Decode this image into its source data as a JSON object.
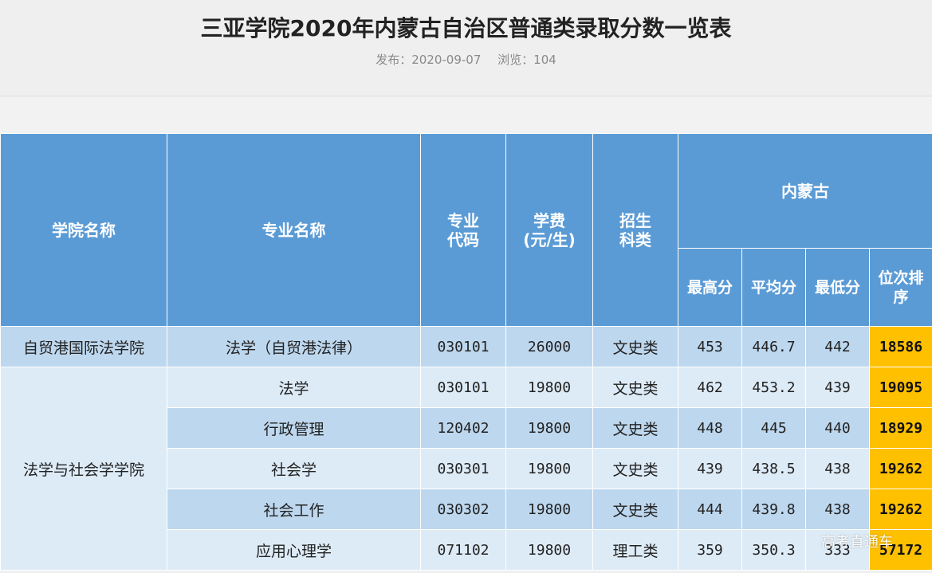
{
  "page": {
    "title": "三亚学院2020年内蒙古自治区普通类录取分数一览表",
    "publish_label": "发布：2020-09-07",
    "views_label": "浏览：104"
  },
  "table": {
    "headers": {
      "college": "学院名称",
      "major": "专业名称",
      "code_line1": "专业",
      "code_line2": "代码",
      "fee_line1": "学费",
      "fee_line2": "(元/生)",
      "category_line1": "招生",
      "category_line2": "科类",
      "region": "内蒙古",
      "max": "最高分",
      "avg": "平均分",
      "min": "最低分",
      "rank_line1": "位次排",
      "rank_line2": "序"
    },
    "rows": [
      {
        "college": "自贸港国际法学院",
        "major": "法学（自贸港法律）",
        "code": "030101",
        "fee": "26000",
        "category": "文史类",
        "max": "453",
        "avg": "446.7",
        "min": "442",
        "rank": "18586"
      },
      {
        "college": "法学与社会学学院",
        "major": "法学",
        "code": "030101",
        "fee": "19800",
        "category": "文史类",
        "max": "462",
        "avg": "453.2",
        "min": "439",
        "rank": "19095"
      },
      {
        "major": "行政管理",
        "code": "120402",
        "fee": "19800",
        "category": "文史类",
        "max": "448",
        "avg": "445",
        "min": "440",
        "rank": "18929"
      },
      {
        "major": "社会学",
        "code": "030301",
        "fee": "19800",
        "category": "文史类",
        "max": "439",
        "avg": "438.5",
        "min": "438",
        "rank": "19262"
      },
      {
        "major": "社会工作",
        "code": "030302",
        "fee": "19800",
        "category": "文史类",
        "max": "444",
        "avg": "439.8",
        "min": "438",
        "rank": "19262"
      },
      {
        "major": "应用心理学",
        "code": "071102",
        "fee": "19800",
        "category": "理工类",
        "max": "359",
        "avg": "350.3",
        "min": "333",
        "rank": "57172"
      }
    ]
  },
  "watermark": "高考直通车",
  "colors": {
    "header_blue": "#5b9bd5",
    "row_dark": "#bdd7ee",
    "row_light": "#ddebf7",
    "rank_highlight": "#ffc000"
  }
}
